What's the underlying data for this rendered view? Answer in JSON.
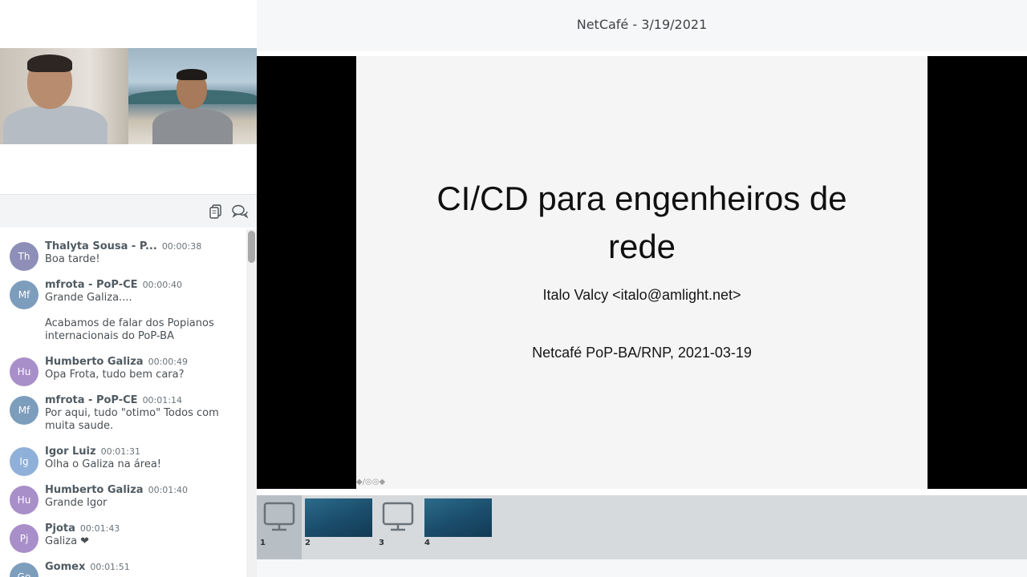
{
  "window": {
    "title": "NetCafé - 3/19/2021"
  },
  "webcams": [
    {
      "name": "webcam-participant-1"
    },
    {
      "name": "webcam-participant-2"
    }
  ],
  "chat": {
    "icons": [
      "copy-icon",
      "chat-bubbles-icon"
    ],
    "messages": [
      {
        "initials": "Th",
        "color": "#8e8fb8",
        "name": "Thalyta Sousa - P...",
        "time": "00:00:38",
        "text": "Boa tarde!"
      },
      {
        "initials": "Mf",
        "color": "#7d9dbd",
        "name": "mfrota - PoP-CE",
        "time": "00:00:40",
        "text": "Grande Galiza...."
      },
      {
        "initials": "",
        "color": "",
        "name": "",
        "time": "",
        "text": "Acabamos de falar dos Popianos internacionais do PoP-BA"
      },
      {
        "initials": "Hu",
        "color": "#a98fc9",
        "name": "Humberto Galiza",
        "time": "00:00:49",
        "text": "Opa Frota, tudo bem cara?"
      },
      {
        "initials": "Mf",
        "color": "#7d9dbd",
        "name": "mfrota - PoP-CE",
        "time": "00:01:14",
        "text": "Por aqui, tudo \"otimo\" Todos com muita saude."
      },
      {
        "initials": "Ig",
        "color": "#8fb0d8",
        "name": "Igor Luiz",
        "time": "00:01:31",
        "text": "Olha o Galiza na área!"
      },
      {
        "initials": "Hu",
        "color": "#a98fc9",
        "name": "Humberto Galiza",
        "time": "00:01:40",
        "text": "Grande Igor"
      },
      {
        "initials": "Pj",
        "color": "#a98fc9",
        "name": "Pjota",
        "time": "00:01:43",
        "text": "Galiza ❤"
      },
      {
        "initials": "Go",
        "color": "#7d9dbd",
        "name": "Gomex",
        "time": "00:01:51",
        "text": ""
      }
    ]
  },
  "slide": {
    "title_line1": "CI/CD para engenheiros de",
    "title_line2": "rede",
    "author": "Italo Valcy <italo@amlight.net>",
    "event": "Netcafé PoP-BA/RNP, 2021-03-19",
    "tools": "◆/◎◎◆"
  },
  "thumbnails": [
    {
      "num": "1",
      "kind": "monitor",
      "selected": true
    },
    {
      "num": "2",
      "kind": "slide",
      "selected": false
    },
    {
      "num": "3",
      "kind": "monitor",
      "selected": false
    },
    {
      "num": "4",
      "kind": "slide",
      "selected": false
    }
  ]
}
